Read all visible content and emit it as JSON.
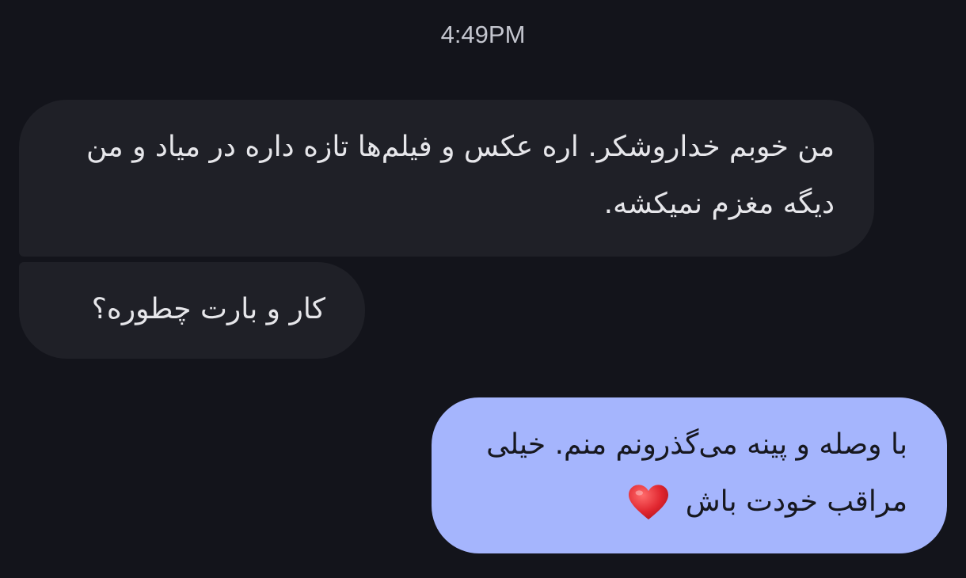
{
  "timestamp": "4:49PM",
  "messages": [
    {
      "direction": "incoming",
      "text": "من خوبم خداروشکر. اره عکس و فیلم‌ها تازه داره در میاد و من دیگه مغزم نمیکشه."
    },
    {
      "direction": "incoming",
      "text": "کار و بارت چطوره؟"
    },
    {
      "direction": "outgoing",
      "text": "با وصله و پینه می‌گذرونم منم. خیلی مراقب خودت باش",
      "emoji": "heart-emoji"
    }
  ],
  "colors": {
    "background": "#13141b",
    "incoming_bubble": "#1f2027",
    "outgoing_bubble": "#a5b5fd",
    "heart": "#e0262f"
  }
}
